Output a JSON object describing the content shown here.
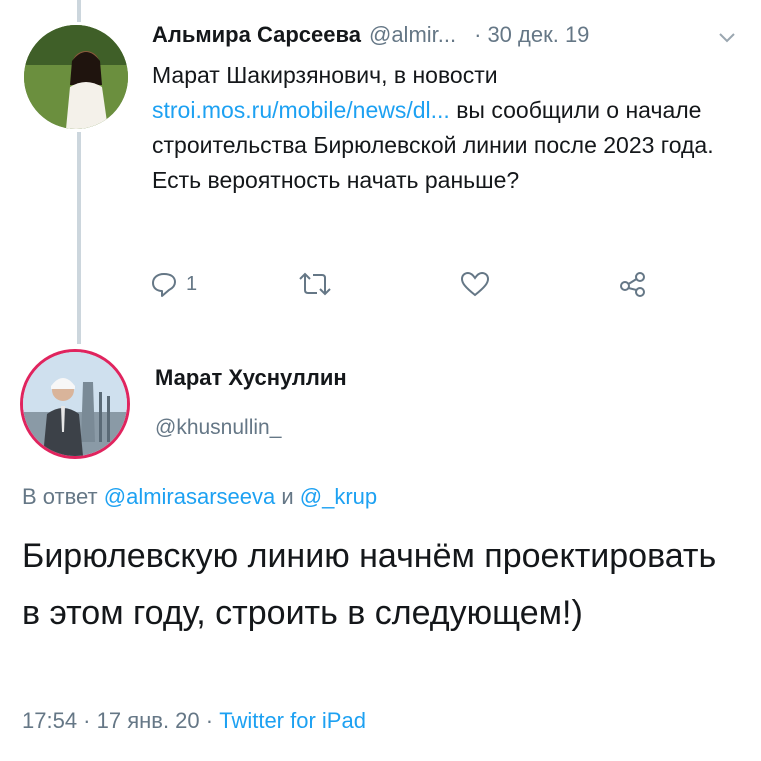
{
  "parent_tweet": {
    "author_name": "Альмира Сарсеева",
    "handle": "@almir...",
    "separator": "·",
    "date": "30 дек. 19",
    "text_before_link": "Марат Шакирзянович, в новости ",
    "link": "stroi.mos.ru/mobile/news/dl...",
    "text_after_link": " вы сообщили о начале строительства Бирюлевской линии после 2023 года. Есть вероятность начать раньше?",
    "reply_count": "1",
    "icons": [
      "reply-icon",
      "retweet-icon",
      "like-icon",
      "share-icon",
      "chevron-down-icon"
    ]
  },
  "main_tweet": {
    "author_name": "Марат Хуснуллин",
    "handle": "@khusnullin_",
    "reply_prefix": "В ответ ",
    "mention_1": "@almirasarseeva",
    "reply_joiner": " и ",
    "mention_2": "@_krup",
    "text": "Бирюлевскую линию начнём проектировать в этом году, строить в следующем!)",
    "time": "17:54",
    "separator": " · ",
    "date": "17 янв. 20",
    "source": "Twitter for iPad"
  },
  "colors": {
    "link": "#1da1f2",
    "secondary_text": "#657786",
    "primary_text": "#14171a",
    "thread_line": "#ccd6dd",
    "avatar_ring": "#e0245e"
  }
}
